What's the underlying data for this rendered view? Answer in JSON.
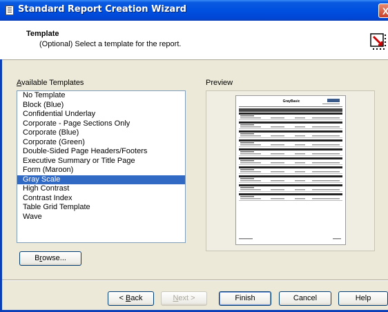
{
  "window": {
    "title": "Standard Report Creation Wizard",
    "close_label": "X"
  },
  "header": {
    "title": "Template",
    "subtitle": "(Optional) Select a template for the report."
  },
  "available": {
    "label_accel": "A",
    "label_rest": "vailable Templates",
    "items": [
      "No Template",
      "Block (Blue)",
      "Confidential Underlay",
      "Corporate - Page Sections Only",
      "Corporate (Blue)",
      "Corporate (Green)",
      "Double-Sided Page Headers/Footers",
      "Executive Summary or Title Page",
      "Form (Maroon)",
      "Gray Scale",
      "High Contrast",
      "Contrast Index",
      "Table Grid Template",
      "Wave"
    ],
    "selected_index": 9
  },
  "preview": {
    "label": "Preview",
    "page_title": "GrayBasic"
  },
  "buttons": {
    "browse_a": "B",
    "browse_accel": "r",
    "browse_b": "owse...",
    "back_a": "< ",
    "back_accel": "B",
    "back_b": "ack",
    "next_accel": "N",
    "next_b": "ext >",
    "finish": "Finish",
    "cancel": "Cancel",
    "help": "Help"
  }
}
